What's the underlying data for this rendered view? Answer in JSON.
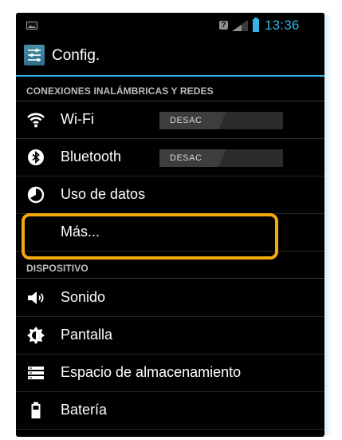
{
  "status_bar": {
    "time": "13:36",
    "icons": [
      "screenshot-icon",
      "question-icon",
      "signal-icon",
      "battery-icon"
    ],
    "accent": "#33b5e5"
  },
  "action_bar": {
    "title": "Config.",
    "icon": "settings-app-icon"
  },
  "sections": {
    "wireless": {
      "title": "CONEXIONES INALÁMBRICAS Y REDES",
      "items": {
        "wifi": {
          "label": "Wi-Fi",
          "icon": "wifi-icon",
          "toggle": "DESAC"
        },
        "bluetooth": {
          "label": "Bluetooth",
          "icon": "bluetooth-icon",
          "toggle": "DESAC"
        },
        "data_usage": {
          "label": "Uso de datos",
          "icon": "data-usage-icon"
        },
        "more": {
          "label": "Más..."
        }
      }
    },
    "device": {
      "title": "DISPOSITIVO",
      "items": {
        "sound": {
          "label": "Sonido",
          "icon": "speaker-icon"
        },
        "display": {
          "label": "Pantalla",
          "icon": "brightness-icon"
        },
        "storage": {
          "label": "Espacio de almacenamiento",
          "icon": "storage-icon"
        },
        "battery": {
          "label": "Batería",
          "icon": "battery-icon"
        }
      }
    }
  },
  "annotation": {
    "highlight_color": "#f4a90c"
  }
}
